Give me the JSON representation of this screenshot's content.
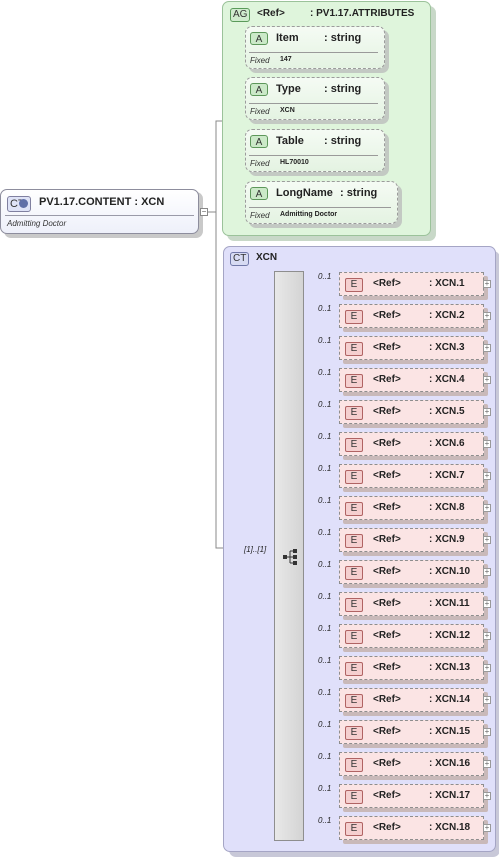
{
  "root": {
    "badge": "CT",
    "title": "PV1.17.CONTENT : XCN",
    "description": "Admitting Doctor",
    "collapse_symbol": "−"
  },
  "attribute_group": {
    "badge": "AG",
    "ref": "<Ref>",
    "name": ": PV1.17.ATTRIBUTES",
    "attributes": [
      {
        "badge": "A",
        "name": "Item",
        "type": ": string",
        "fixed_label": "Fixed",
        "fixed_value": "147"
      },
      {
        "badge": "A",
        "name": "Type",
        "type": ": string",
        "fixed_label": "Fixed",
        "fixed_value": "XCN"
      },
      {
        "badge": "A",
        "name": "Table",
        "type": ": string",
        "fixed_label": "Fixed",
        "fixed_value": "HL70010"
      },
      {
        "badge": "A",
        "name": "LongName",
        "type": ": string",
        "fixed_label": "Fixed",
        "fixed_value": "Admitting Doctor"
      }
    ]
  },
  "complex_type": {
    "badge": "CT",
    "name": "XCN",
    "sequence_cardinality": "[1]..[1]",
    "elements": [
      {
        "badge": "E",
        "ref": "<Ref>",
        "name": ": XCN.1",
        "cardinality": "0..1",
        "expand": "+"
      },
      {
        "badge": "E",
        "ref": "<Ref>",
        "name": ": XCN.2",
        "cardinality": "0..1",
        "expand": "+"
      },
      {
        "badge": "E",
        "ref": "<Ref>",
        "name": ": XCN.3",
        "cardinality": "0..1",
        "expand": "+"
      },
      {
        "badge": "E",
        "ref": "<Ref>",
        "name": ": XCN.4",
        "cardinality": "0..1",
        "expand": "+"
      },
      {
        "badge": "E",
        "ref": "<Ref>",
        "name": ": XCN.5",
        "cardinality": "0..1",
        "expand": "+"
      },
      {
        "badge": "E",
        "ref": "<Ref>",
        "name": ": XCN.6",
        "cardinality": "0..1",
        "expand": "+"
      },
      {
        "badge": "E",
        "ref": "<Ref>",
        "name": ": XCN.7",
        "cardinality": "0..1",
        "expand": "+"
      },
      {
        "badge": "E",
        "ref": "<Ref>",
        "name": ": XCN.8",
        "cardinality": "0..1",
        "expand": "+"
      },
      {
        "badge": "E",
        "ref": "<Ref>",
        "name": ": XCN.9",
        "cardinality": "0..1",
        "expand": "+"
      },
      {
        "badge": "E",
        "ref": "<Ref>",
        "name": ": XCN.10",
        "cardinality": "0..1",
        "expand": "+"
      },
      {
        "badge": "E",
        "ref": "<Ref>",
        "name": ": XCN.11",
        "cardinality": "0..1",
        "expand": "+"
      },
      {
        "badge": "E",
        "ref": "<Ref>",
        "name": ": XCN.12",
        "cardinality": "0..1",
        "expand": "+"
      },
      {
        "badge": "E",
        "ref": "<Ref>",
        "name": ": XCN.13",
        "cardinality": "0..1",
        "expand": "+"
      },
      {
        "badge": "E",
        "ref": "<Ref>",
        "name": ": XCN.14",
        "cardinality": "0..1",
        "expand": "+"
      },
      {
        "badge": "E",
        "ref": "<Ref>",
        "name": ": XCN.15",
        "cardinality": "0..1",
        "expand": "+"
      },
      {
        "badge": "E",
        "ref": "<Ref>",
        "name": ": XCN.16",
        "cardinality": "0..1",
        "expand": "+"
      },
      {
        "badge": "E",
        "ref": "<Ref>",
        "name": ": XCN.17",
        "cardinality": "0..1",
        "expand": "+"
      },
      {
        "badge": "E",
        "ref": "<Ref>",
        "name": ": XCN.18",
        "cardinality": "0..1",
        "expand": "+"
      }
    ]
  }
}
